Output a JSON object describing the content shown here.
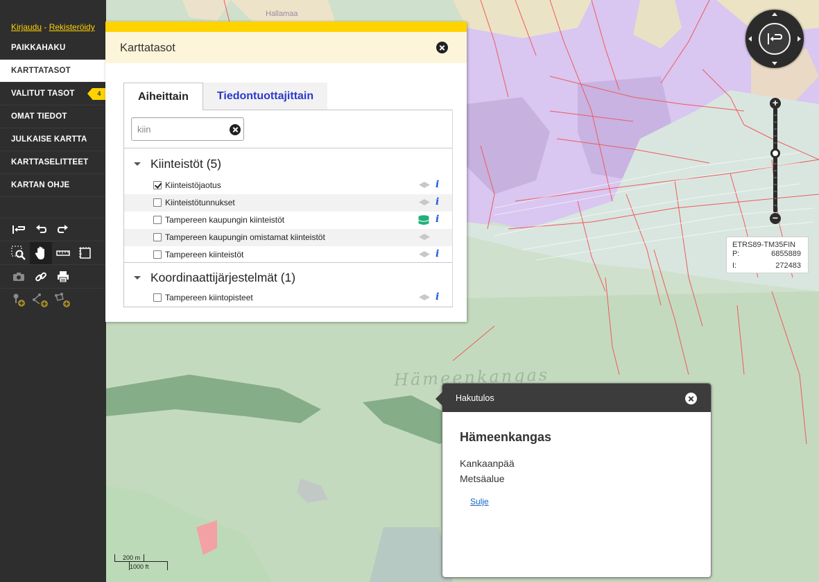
{
  "auth": {
    "login": "Kirjaudu",
    "separator": " - ",
    "register": "Rekisteröidy"
  },
  "nav": {
    "items": [
      {
        "label": "PAIKKAHAKU"
      },
      {
        "label": "KARTTATASOT"
      },
      {
        "label": "VALITUT TASOT",
        "badge": "4"
      },
      {
        "label": "OMAT TIEDOT"
      },
      {
        "label": "JULKAISE KARTTA"
      },
      {
        "label": "KARTTASELITTEET"
      },
      {
        "label": "KARTAN OHJE"
      }
    ],
    "active": "KARTTATASOT"
  },
  "tools": {
    "row1": [
      "first-view-icon",
      "undo-icon",
      "redo-icon"
    ],
    "row2": [
      "zoom-box-icon",
      "pan-hand-icon",
      "measure-line-icon",
      "measure-area-icon"
    ],
    "row3": [
      "screenshot-icon",
      "link-icon",
      "print-icon"
    ],
    "row4": [
      "add-point-icon",
      "add-line-icon",
      "add-area-icon"
    ],
    "selected": "pan-hand-icon"
  },
  "flyout": {
    "title": "Karttatasot",
    "tabs": [
      {
        "label": "Aiheittain"
      },
      {
        "label": "Tiedontuottajittain"
      }
    ],
    "active_tab": "Aiheittain",
    "search": {
      "value": "kiin",
      "placeholder": ""
    },
    "groups": [
      {
        "title": "Kiinteistöt (5)",
        "layers": [
          {
            "name": "Kiinteistöjaotus",
            "checked": true,
            "info": true
          },
          {
            "name": "Kiinteistötunnukset",
            "checked": false,
            "info": true
          },
          {
            "name": "Tampereen kaupungin kiinteistöt",
            "checked": false,
            "info": true,
            "icon": "database-icon"
          },
          {
            "name": "Tampereen kaupungin omistamat kiinteistöt",
            "checked": false,
            "info": false
          },
          {
            "name": "Tampereen kiinteistöt",
            "checked": false,
            "info": true
          }
        ]
      },
      {
        "title": "Koordinaattijärjestelmät (1)",
        "layers": [
          {
            "name": "Tampereen kiintopisteet",
            "checked": false,
            "info": true
          }
        ]
      }
    ],
    "info_glyph": "i"
  },
  "map": {
    "place_name": "Hämeenkangas",
    "place_small": "Hallamaa"
  },
  "zoom": {
    "plus": "+",
    "minus": "−",
    "level_fraction": 0.43
  },
  "coordinates": {
    "crs": "ETRS89-TM35FIN",
    "p_label": "P:",
    "p_value": "6855889",
    "i_label": "I:",
    "i_value": "272483"
  },
  "scalebar": {
    "metric": "200 m",
    "imperial": "1000 ft"
  },
  "popup": {
    "header": "Hakutulos",
    "name": "Hämeenkangas",
    "line1": "Kankaanpää",
    "line2": "Metsäalue",
    "close_link": "Sulje"
  },
  "colors": {
    "sidebar": "#2e2e2e",
    "accent_yellow": "#ffd300",
    "flyout_header": "#fdf5d9",
    "tab_link": "#2b39cc",
    "info_blue": "#1d5fdc",
    "map_green": "#c9dcc6",
    "map_purple": "#d8c4f0"
  }
}
